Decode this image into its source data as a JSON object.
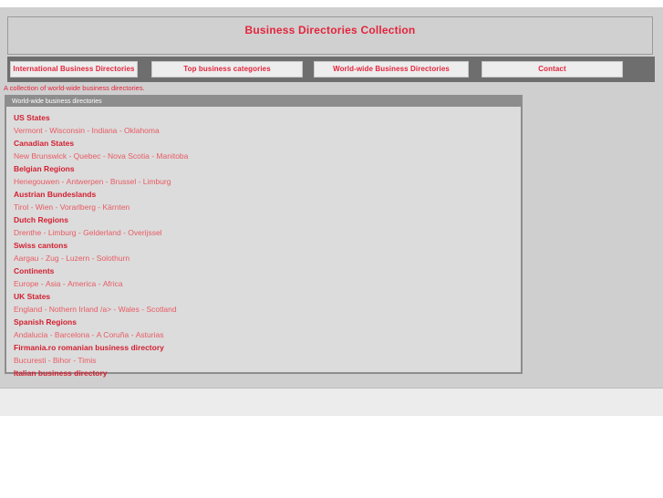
{
  "header": {
    "site_title": "Business Directories Collection",
    "tagline": "A collection of world-wide business directories."
  },
  "nav": {
    "tabs": [
      {
        "label": "International Business Directories"
      },
      {
        "label": "Top business categories"
      },
      {
        "label": "World-wide Business Directories"
      },
      {
        "label": "Contact"
      }
    ]
  },
  "panel": {
    "title": "World-wide business directories",
    "groups": [
      {
        "heading": "US States",
        "links": [
          "Vermont",
          "Wisconsin",
          "Indiana",
          "Oklahoma"
        ]
      },
      {
        "heading": "Canadian States",
        "links": [
          "New Brunswick",
          "Quebec",
          "Nova Scotia",
          "Manitoba"
        ]
      },
      {
        "heading": "Belgian Regions",
        "links": [
          "Henegouwen",
          "Antwerpen",
          "Brussel",
          "Limburg"
        ]
      },
      {
        "heading": "Austrian Bundeslands",
        "links": [
          "Tirol",
          "Wien",
          "Vorarlberg",
          "Kärnten"
        ]
      },
      {
        "heading": "Dutch Regions",
        "links": [
          "Drenthe",
          "Limburg",
          "Gelderland",
          "Overijssel"
        ]
      },
      {
        "heading": "Swiss cantons",
        "links": [
          "Aargau",
          "Zug",
          "Luzern",
          "Solothurn"
        ]
      },
      {
        "heading": "Continents",
        "links": [
          "Europe",
          "Asia",
          "America",
          "Africa"
        ]
      },
      {
        "heading": "UK States",
        "links": [
          "England",
          "Nothern Irland /a>",
          "Wales",
          "Scotland"
        ]
      },
      {
        "heading": "Spanish Regions",
        "links": [
          "Andalucia",
          "Barcelona",
          "A Coruña",
          "Asturias"
        ]
      },
      {
        "heading": "Firmania.ro romanian business directory",
        "links": [
          "Bucuresti",
          "Bihor",
          "Timis"
        ]
      },
      {
        "heading": "Italian business directory",
        "links": []
      }
    ]
  },
  "colors": {
    "accent_red": "#e3243c",
    "heading_red": "#d31f30",
    "link_red": "#e85b63",
    "page_grey": "#cfcfcf",
    "nav_strip_grey": "#6e6e6e",
    "panel_border_grey": "#8d8d8d",
    "panel_bg": "#dcdcdc"
  },
  "separator": "-"
}
